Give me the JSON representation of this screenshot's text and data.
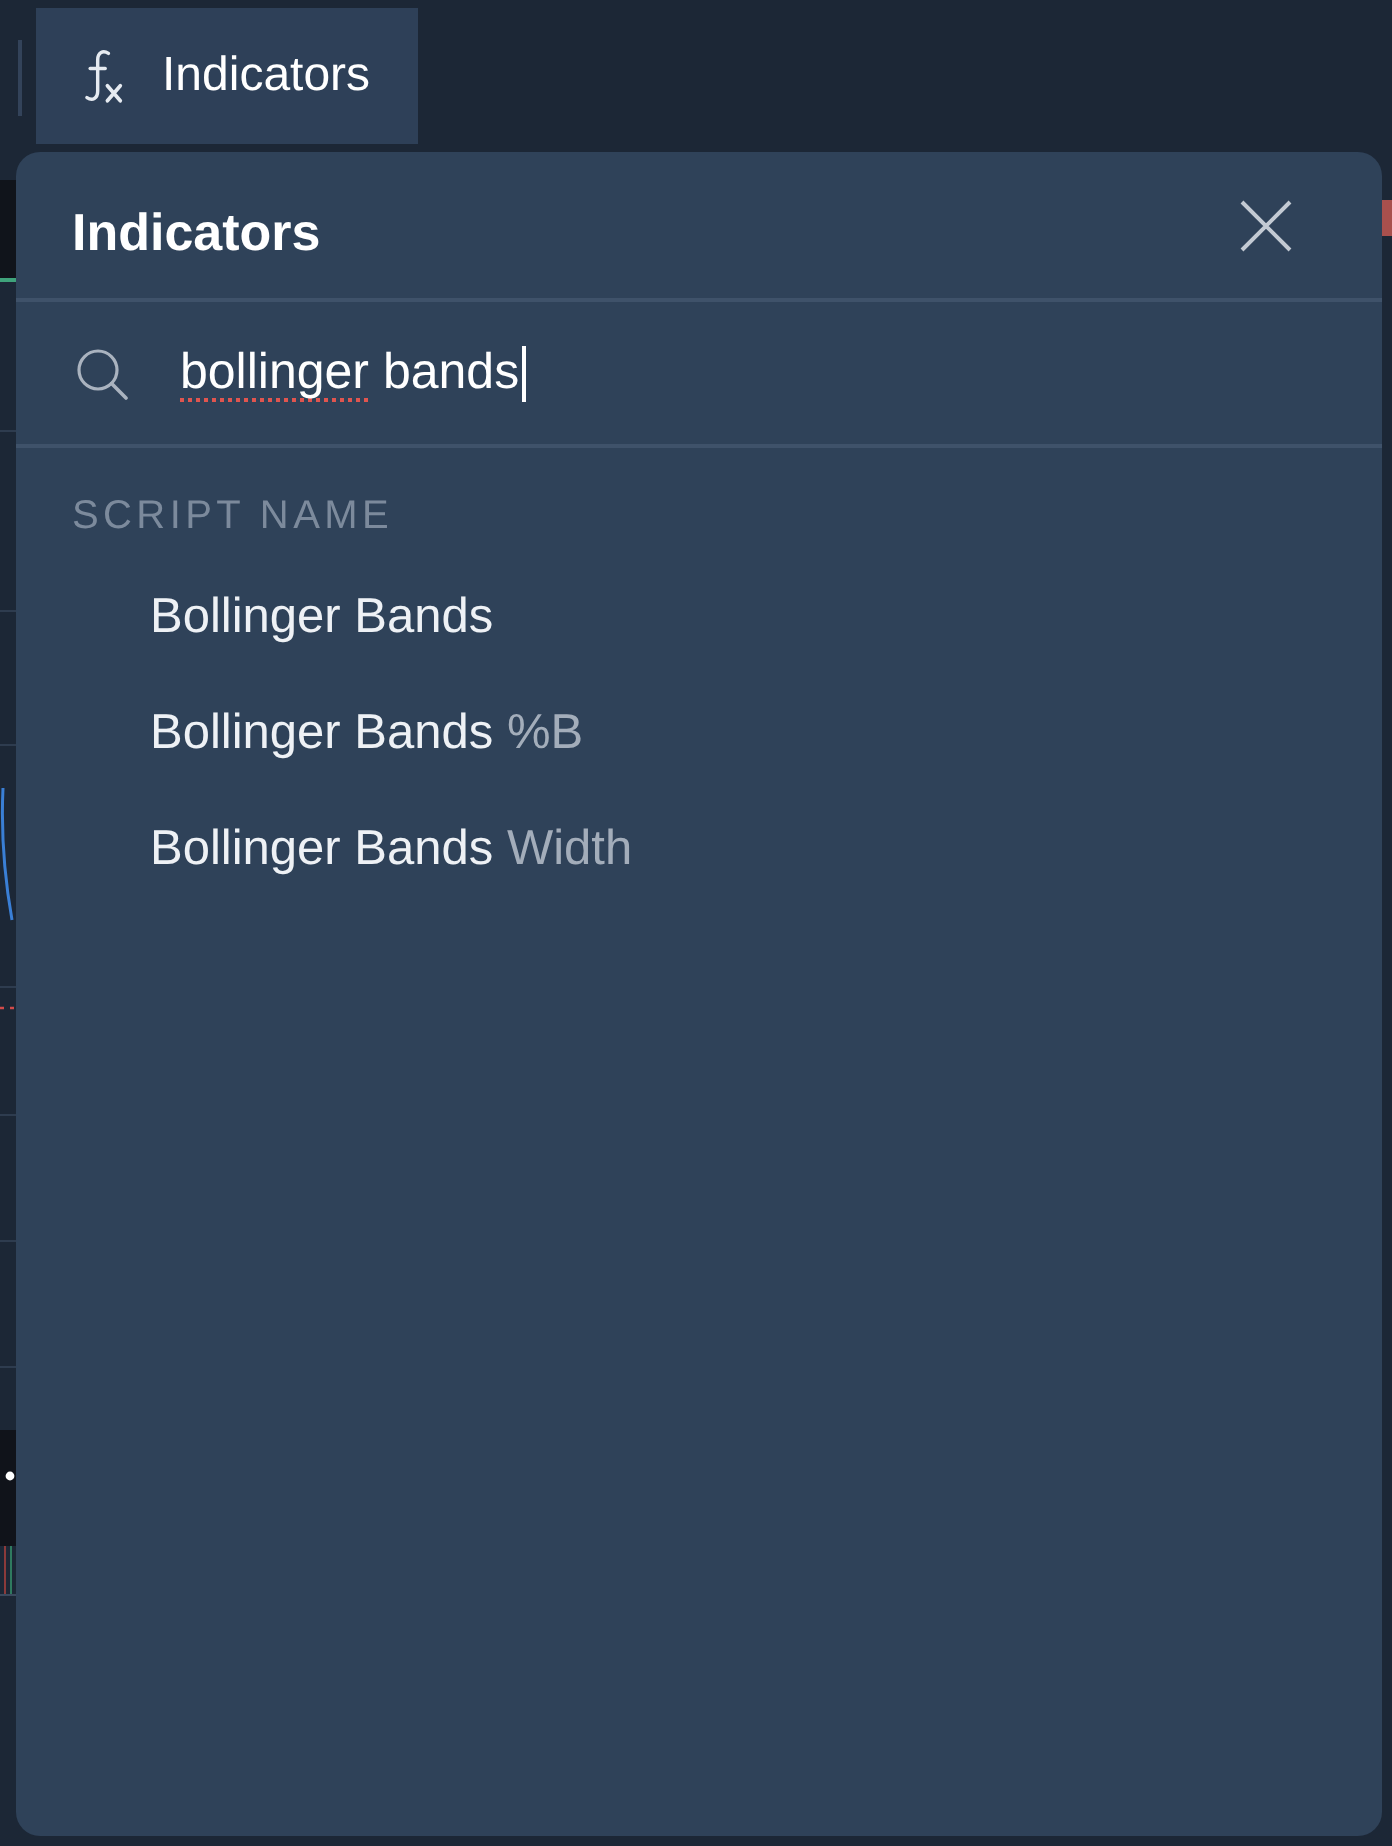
{
  "toolbar": {
    "indicators_button": {
      "label": "Indicators",
      "selected": true
    }
  },
  "dialog": {
    "title": "Indicators",
    "search": {
      "value": [
        {
          "text": "bollinger",
          "misspelled": true
        },
        {
          "text": " bands",
          "misspelled": false
        }
      ],
      "focused": true
    },
    "section_label": "SCRIPT NAME",
    "results": [
      {
        "match": "Bollinger Bands"
      },
      {
        "match": "Bollinger Bands",
        "rest": "%B"
      },
      {
        "match": "Bollinger Bands",
        "rest": "Width"
      }
    ]
  }
}
